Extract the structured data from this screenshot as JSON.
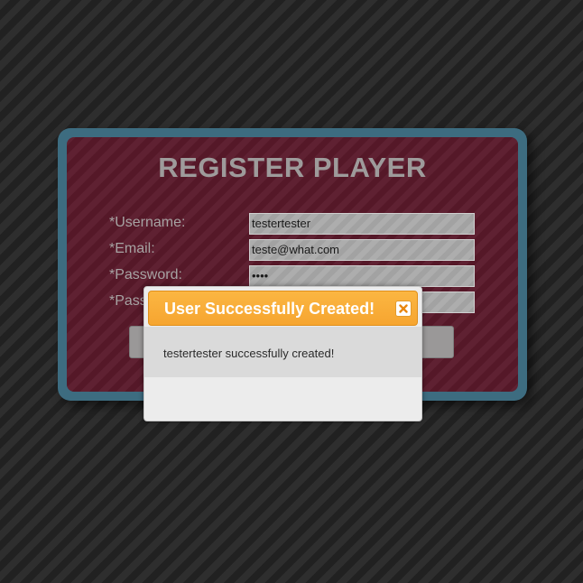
{
  "register_form": {
    "title": "REGISTER PLAYER",
    "fields": [
      {
        "label": "*Username:",
        "value": "testertester"
      },
      {
        "label": "*Email:",
        "value": "teste@what.com"
      },
      {
        "label": "*Password:",
        "value": "••••"
      },
      {
        "label": "*Password:",
        "value": ""
      }
    ],
    "submit_label": ""
  },
  "dialog": {
    "title": "User Successfully Created!",
    "close_icon": "close-icon",
    "message": "testertester successfully created!"
  },
  "colors": {
    "background": "#262626",
    "panel_border": "#3d6c80",
    "panel_fill": "#5a1a2b",
    "dialog_header": "#f6a530",
    "close_x": "#e8860f"
  }
}
